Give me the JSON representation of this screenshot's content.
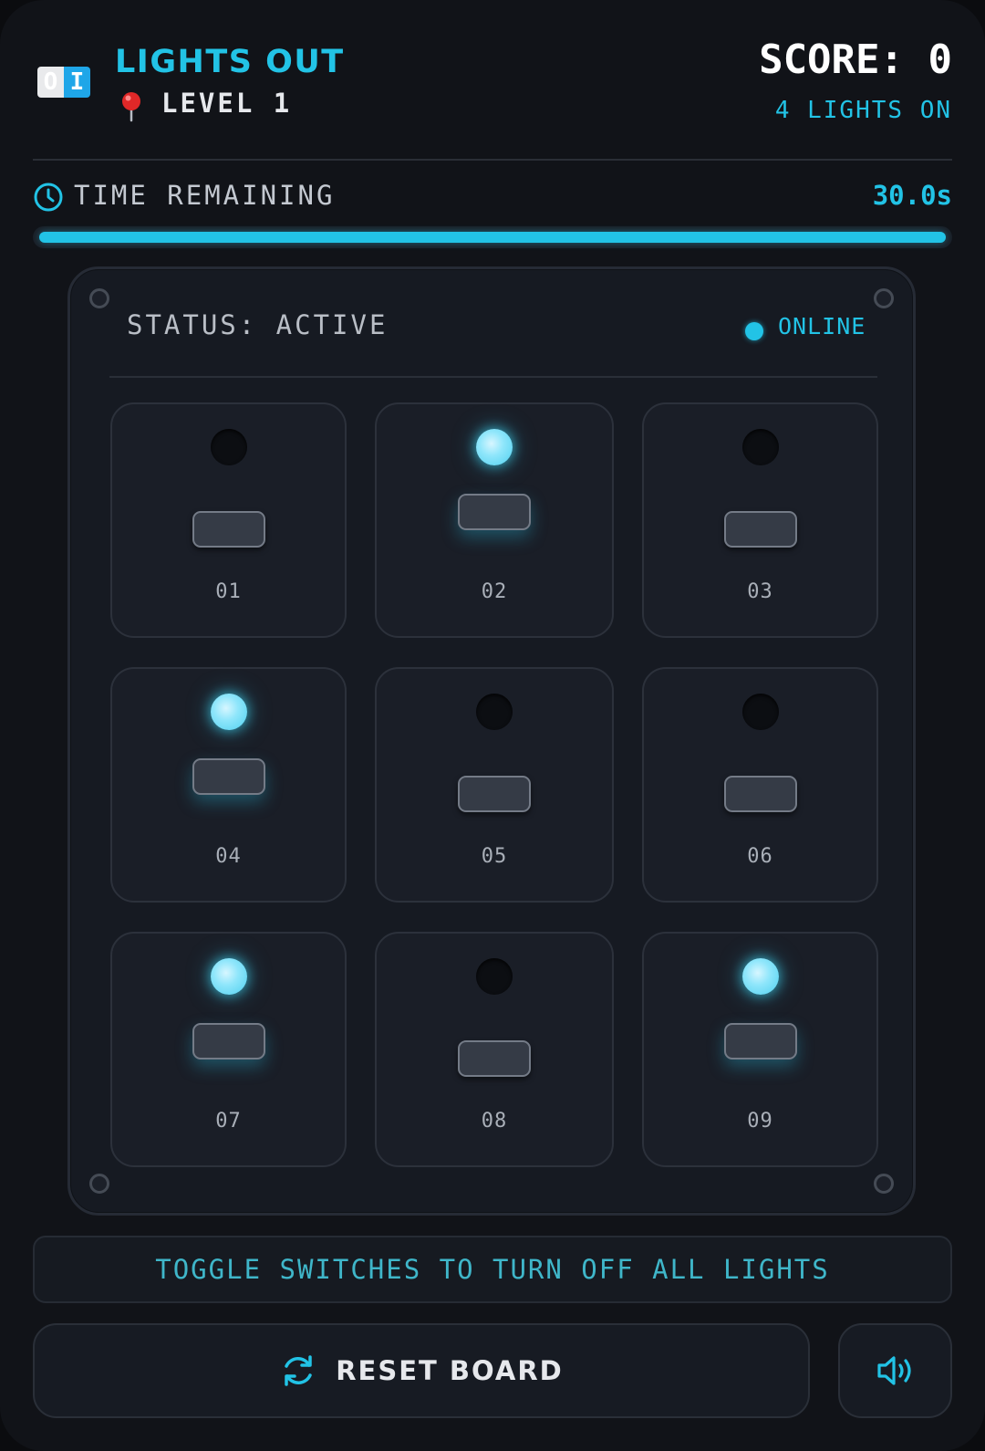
{
  "header": {
    "logo": {
      "off_glyph": "O",
      "on_glyph": "I"
    },
    "title": "LIGHTS OUT",
    "level_label": "LEVEL 1",
    "score_label": "SCORE: 0",
    "lights_on_label": "4 LIGHTS ON"
  },
  "timer": {
    "label": "TIME REMAINING",
    "value": "30.0s",
    "progress_fraction": 1.0
  },
  "panel": {
    "status_label": "STATUS: ACTIVE",
    "online_label": "ONLINE",
    "cells": [
      {
        "label": "01",
        "on": false
      },
      {
        "label": "02",
        "on": true
      },
      {
        "label": "03",
        "on": false
      },
      {
        "label": "04",
        "on": true
      },
      {
        "label": "05",
        "on": false
      },
      {
        "label": "06",
        "on": false
      },
      {
        "label": "07",
        "on": true
      },
      {
        "label": "08",
        "on": false
      },
      {
        "label": "09",
        "on": true
      }
    ]
  },
  "hint": "TOGGLE SWITCHES TO TURN OFF ALL LIGHTS",
  "controls": {
    "reset_label": "RESET BOARD",
    "reset_icon": "refresh-icon",
    "sound_icon": "speaker-icon"
  },
  "colors": {
    "accent": "#22c3e6",
    "background": "#111318",
    "panel": "#161a22"
  }
}
